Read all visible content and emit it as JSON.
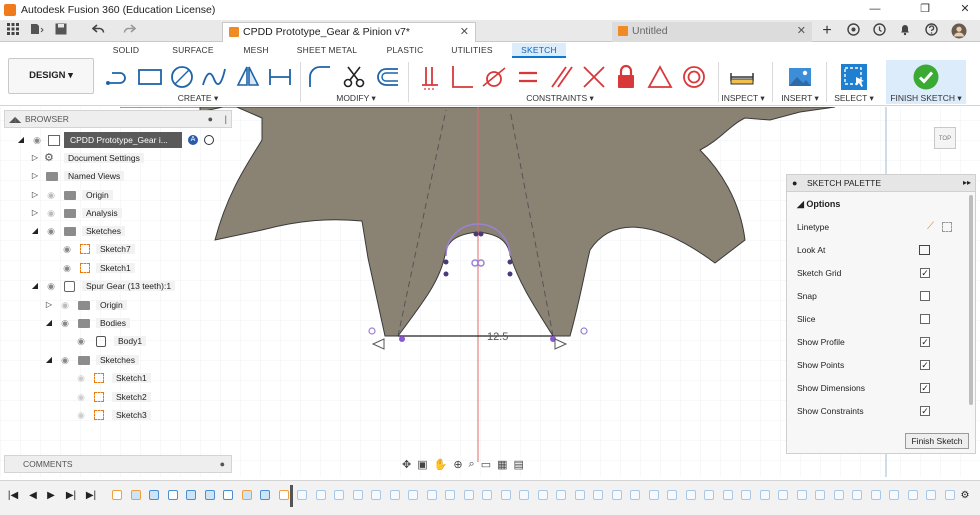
{
  "window": {
    "title": "Autodesk Fusion 360 (Education License)",
    "min_glyph": "—",
    "max_glyph": "❐",
    "close_glyph": "✕"
  },
  "tabs": {
    "active": "CPDD Prototype_Gear & Pinion v7*",
    "inactive": "Untitled",
    "close_glyph": "✕",
    "add_glyph": "+"
  },
  "workspace_tabs": [
    "SOLID",
    "SURFACE",
    "MESH",
    "SHEET METAL",
    "PLASTIC",
    "UTILITIES",
    "SKETCH"
  ],
  "ribbon": {
    "design_label": "DESIGN ▾",
    "groups": {
      "create": "CREATE ▾",
      "modify": "MODIFY ▾",
      "constraints": "CONSTRAINTS ▾",
      "inspect": "INSPECT ▾",
      "insert": "INSERT ▾",
      "select": "SELECT ▾",
      "finish": "FINISH SKETCH ▾"
    },
    "colors": {
      "accent": "#0a79d6",
      "finish_green": "#3aaa35",
      "constraint_red": "#d9383a"
    }
  },
  "browser": {
    "title": "BROWSER",
    "root": "CPDD Prototype_Gear i...",
    "nodes": {
      "document_settings": "Document Settings",
      "named_views": "Named Views",
      "origin": "Origin",
      "analysis": "Analysis",
      "sketches": "Sketches",
      "sketch7": "Sketch7",
      "sketch1": "Sketch1",
      "spur_gear": "Spur Gear (13 teeth):1",
      "gear_origin": "Origin",
      "bodies": "Bodies",
      "body1": "Body1",
      "gear_sketches": "Sketches",
      "gear_sketch1": "Sketch1",
      "gear_sketch2": "Sketch2",
      "gear_sketch3": "Sketch3"
    }
  },
  "comments": {
    "title": "COMMENTS"
  },
  "canvas": {
    "dimension": "12.5"
  },
  "palette": {
    "title": "SKETCH PALETTE",
    "options_title": "Options",
    "rows": {
      "linetype": "Linetype",
      "look_at": "Look At",
      "sketch_grid": "Sketch Grid",
      "snap": "Snap",
      "slice": "Slice",
      "show_profile": "Show Profile",
      "show_points": "Show Points",
      "show_dimensions": "Show Dimensions",
      "show_constraints": "Show Constraints"
    },
    "checked": {
      "sketch_grid": true,
      "snap": false,
      "slice": false,
      "show_profile": true,
      "show_points": true,
      "show_dimensions": true,
      "show_constraints": true
    },
    "check_glyph": "✓",
    "finish_button": "Finish Sketch"
  },
  "viewcube": {
    "label": "TOP"
  }
}
